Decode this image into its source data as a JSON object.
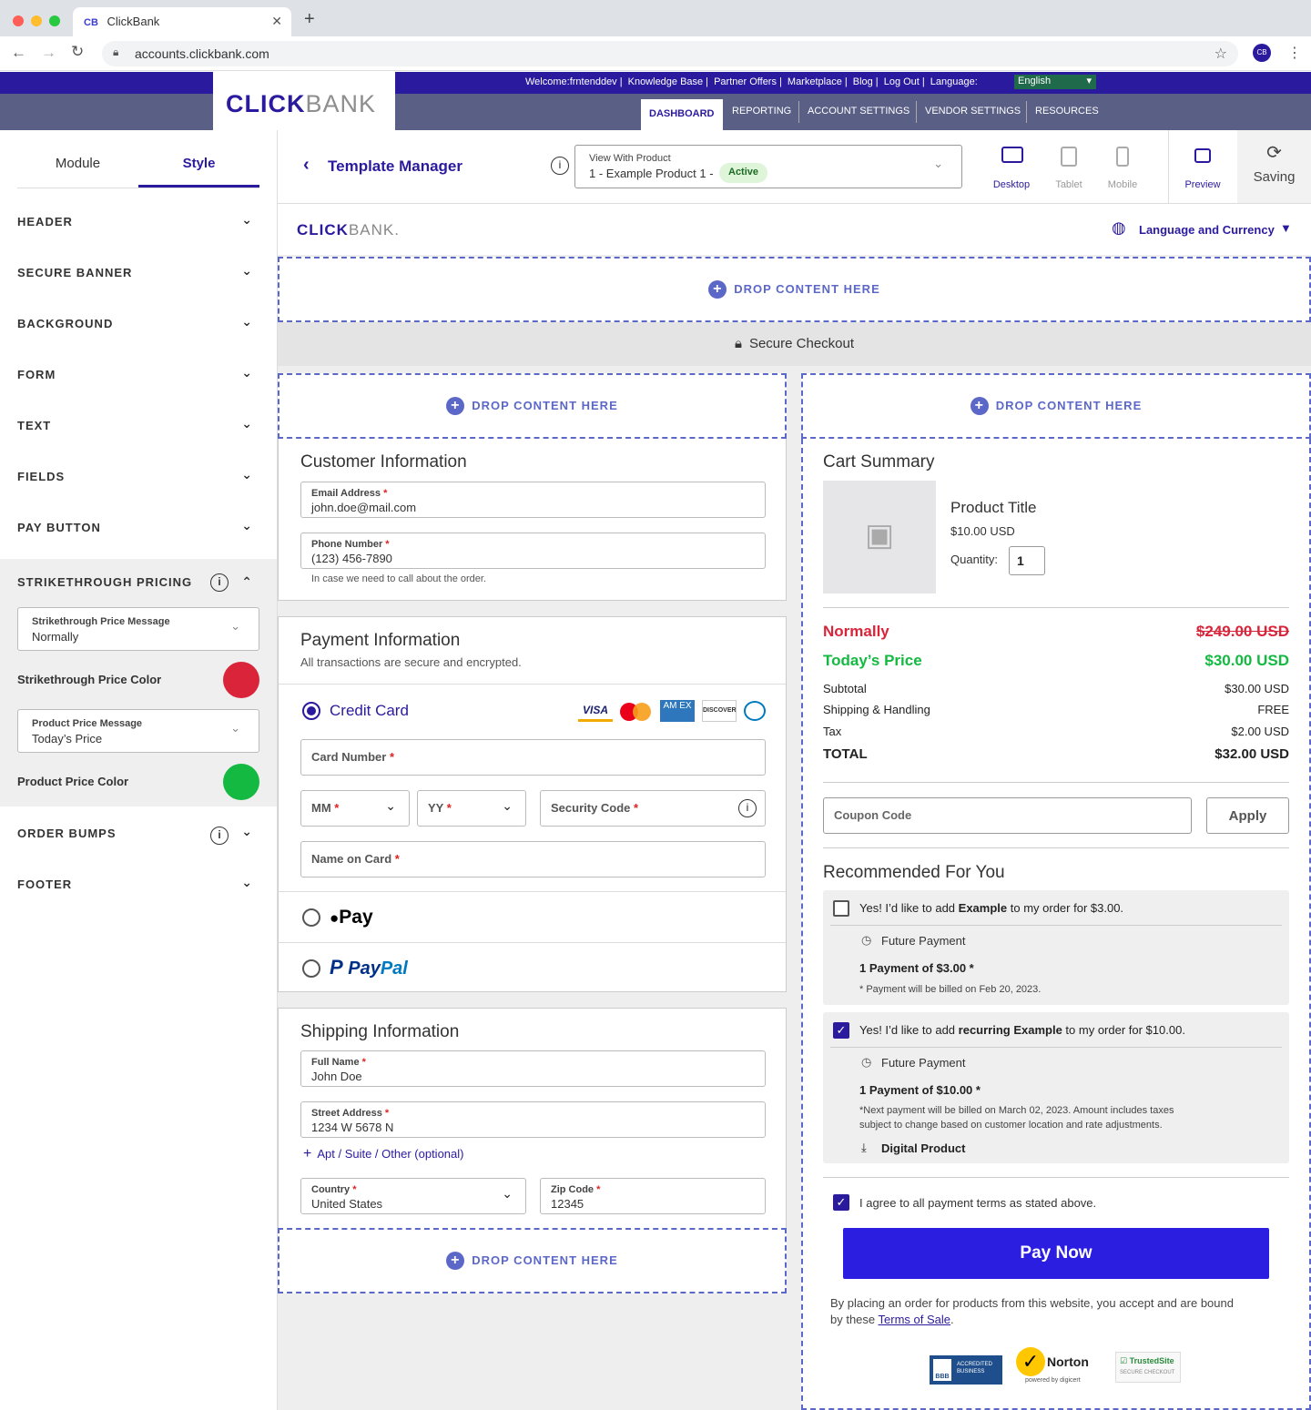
{
  "browser": {
    "tab_title": "ClickBank",
    "tab_favicon": "CB",
    "url": "accounts.clickbank.com",
    "profile": "CB"
  },
  "topbar": {
    "links": [
      "Welcome:frntenddev",
      "Knowledge Base",
      "Partner Offers",
      "Marketplace",
      "Blog",
      "Log Out"
    ],
    "language_label": "Language:",
    "language_value": "English",
    "logo_bold": "CLICK",
    "logo_light": "BANK",
    "nav": [
      "DASHBOARD",
      "REPORTING",
      "ACCOUNT SETTINGS",
      "VENDOR SETTINGS",
      "RESOURCES"
    ]
  },
  "sidebar": {
    "tabs": [
      "Module",
      "Style"
    ],
    "sections": [
      "HEADER",
      "SECURE BANNER",
      "BACKGROUND",
      "FORM",
      "TEXT",
      "FIELDS",
      "PAY BUTTON"
    ],
    "strikethrough": {
      "title": "STRIKETHROUGH PRICING",
      "msg_label": "Strikethrough Price Message",
      "msg_value": "Normally",
      "color_label": "Strikethrough Price Color",
      "color": "#d9243a",
      "product_msg_label": "Product Price Message",
      "product_msg_value": "Today’s Price",
      "product_color_label": "Product Price Color",
      "product_color": "#13b940"
    },
    "after_sections": [
      "ORDER BUMPS",
      "FOOTER"
    ]
  },
  "header": {
    "title": "Template Manager",
    "view_label": "View With Product",
    "view_value": "1 - Example Product 1 -",
    "status": "Active",
    "devices": [
      "Desktop",
      "Tablet",
      "Mobile"
    ],
    "preview": "Preview",
    "saving": "Saving"
  },
  "checkout": {
    "logo_bold": "CLICK",
    "logo_light": "BANK.",
    "lang_currency": "Language and Currency",
    "drop_text": "DROP CONTENT HERE",
    "secure": "Secure Checkout",
    "customer": {
      "title": "Customer Information",
      "email_label": "Email Address",
      "email_value": "john.doe@mail.com",
      "phone_label": "Phone Number",
      "phone_value": "(123) 456-7890",
      "phone_help": "In case we need to call about the order."
    },
    "payment": {
      "title": "Payment Information",
      "subtitle": "All transactions are secure and encrypted.",
      "credit_card": "Credit Card",
      "card_number": "Card Number",
      "mm": "MM",
      "yy": "YY",
      "security": "Security Code",
      "name_on_card": "Name on Card",
      "apple_pay": "Pay",
      "paypal_a": "Pay",
      "paypal_b": "Pal",
      "card_logos": [
        "VISA",
        "AM EX",
        "DISCOVER"
      ]
    },
    "shipping": {
      "title": "Shipping Information",
      "full_name_label": "Full Name",
      "full_name_value": "John Doe",
      "street_label": "Street Address",
      "street_value": "1234 W 5678 N",
      "apt_link": "Apt / Suite / Other (optional)",
      "country_label": "Country",
      "country_value": "United States",
      "zip_label": "Zip Code",
      "zip_value": "12345"
    },
    "cart": {
      "title": "Cart Summary",
      "product_title": "Product Title",
      "product_price": "$10.00 USD",
      "quantity_label": "Quantity:",
      "quantity": "1",
      "normally_label": "Normally",
      "normally_value": "$249.00 USD",
      "today_label": "Today’s Price",
      "today_value": "$30.00 USD",
      "rows": [
        {
          "label": "Subtotal",
          "value": "$30.00 USD"
        },
        {
          "label": "Shipping & Handling",
          "value": "FREE"
        },
        {
          "label": "Tax",
          "value": "$2.00 USD"
        }
      ],
      "total_label": "TOTAL",
      "total_value": "$32.00 USD",
      "coupon_placeholder": "Coupon Code",
      "apply": "Apply"
    },
    "recommended": {
      "title": "Recommended For You",
      "bump1": {
        "pre": "Yes! I’d like to add ",
        "bold": "Example",
        "post": " to my order for $3.00.",
        "future": "Future Payment",
        "payment": "1 Payment of $3.00 *",
        "note": "* Payment will be billed on Feb 20, 2023."
      },
      "bump2": {
        "pre": "Yes! I’d like to add ",
        "bold": "recurring Example",
        "post": " to my order for $10.00.",
        "future": "Future Payment",
        "payment": "1 Payment of $10.00 *",
        "note1": "*Next payment will be billed on March 02, 2023. Amount includes taxes",
        "note2": "subject to change based on customer location and rate adjustments.",
        "digital": "Digital Product"
      }
    },
    "agree": "I agree to all payment terms as stated above.",
    "pay_now": "Pay Now",
    "legal_1": "By placing an order for products from this website, you accept and are bound",
    "legal_2": "by these ",
    "terms": "Terms of Sale",
    "legal_end": ".",
    "badges": {
      "bbb_a": "ACCREDITED",
      "bbb_b": "BUSINESS",
      "bbb_logo": "BBB",
      "norton": "Norton",
      "norton_sub": "powered by digicert",
      "trusted": "TrustedSite",
      "trusted_sub": "SECURE CHECKOUT"
    }
  },
  "colors": {
    "brand": "#2a1a9e",
    "accent": "#5c68c8",
    "pay_button": "#2b1ee0"
  }
}
